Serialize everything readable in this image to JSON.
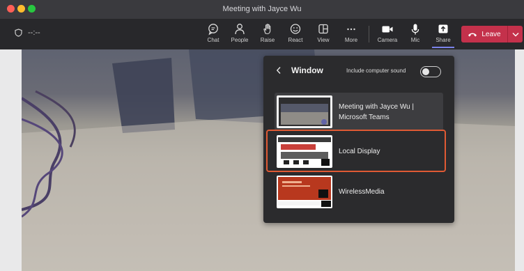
{
  "window": {
    "title": "Meeting with Jayce Wu"
  },
  "toolbar": {
    "timer": "--:--",
    "buttons": [
      {
        "key": "chat",
        "label": "Chat",
        "icon": "chat-icon"
      },
      {
        "key": "people",
        "label": "People",
        "icon": "people-icon"
      },
      {
        "key": "raise",
        "label": "Raise",
        "icon": "raise-hand-icon"
      },
      {
        "key": "react",
        "label": "React",
        "icon": "smiley-icon"
      },
      {
        "key": "view",
        "label": "View",
        "icon": "view-grid-icon"
      },
      {
        "key": "more",
        "label": "More",
        "icon": "ellipsis-icon"
      },
      {
        "key": "camera",
        "label": "Camera",
        "icon": "camera-icon"
      },
      {
        "key": "mic",
        "label": "Mic",
        "icon": "microphone-icon"
      },
      {
        "key": "share",
        "label": "Share",
        "icon": "share-icon"
      }
    ],
    "leave_label": "Leave"
  },
  "share_panel": {
    "title": "Window",
    "include_sound_label": "Include computer sound",
    "include_sound_on": false,
    "items": [
      {
        "label": "Meeting with Jayce Wu | Microsoft Teams",
        "selected": false
      },
      {
        "label": "Local Display",
        "selected": true
      },
      {
        "label": "WirelessMedia",
        "selected": false
      }
    ]
  },
  "colors": {
    "leave": "#c4314b",
    "highlight": "#e05a34",
    "share_accent": "#7b83eb",
    "toolbar": "#28282b"
  }
}
